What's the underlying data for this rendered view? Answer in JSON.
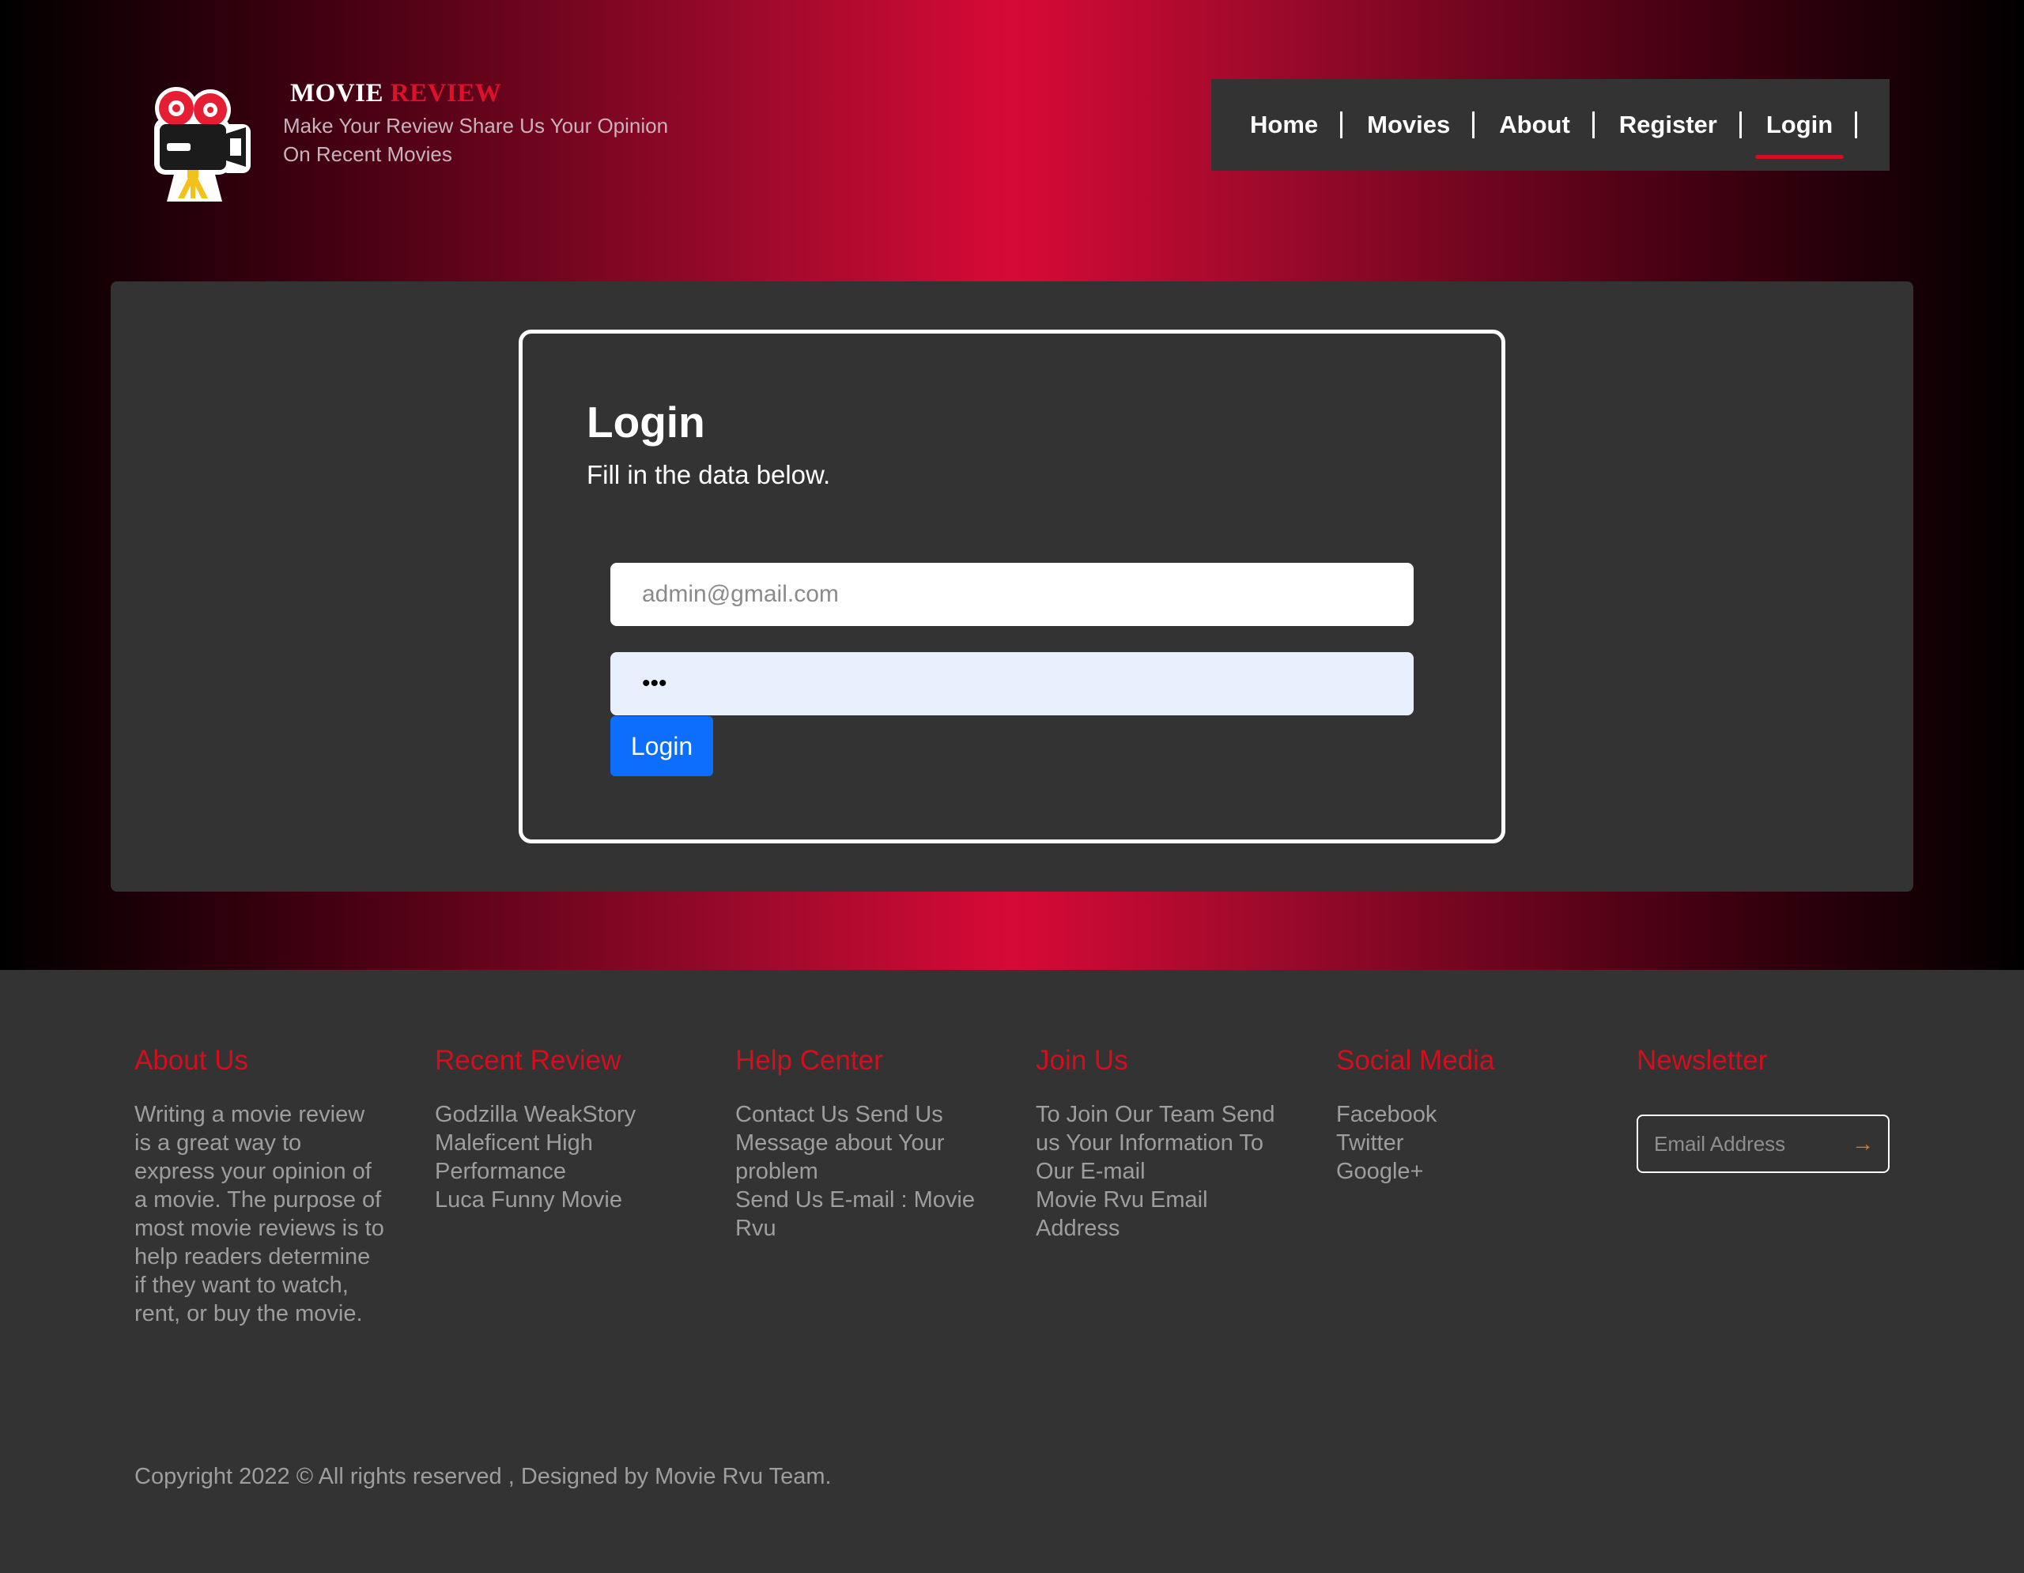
{
  "brand": {
    "title_part1": "MOVIE",
    "title_part2": "REVIEW",
    "tagline_line1": "Make Your Review Share Us Your Opinion",
    "tagline_line2": "On Recent Movies",
    "logo_icon": "movie-camera-icon"
  },
  "nav": {
    "items": [
      {
        "label": "Home"
      },
      {
        "label": "Movies"
      },
      {
        "label": "About"
      },
      {
        "label": "Register"
      },
      {
        "label": "Login",
        "active": true
      }
    ]
  },
  "login": {
    "title": "Login",
    "subtitle": "Fill in the data below.",
    "email_placeholder": "admin@gmail.com",
    "email_value": "",
    "password_value": "•••",
    "button_label": "Login"
  },
  "footer": {
    "about": {
      "heading": "About Us",
      "text": "Writing a movie review is a great way to express your opinion of a movie. The purpose of most movie reviews is to help readers determine if they want to watch, rent, or buy the movie."
    },
    "recent": {
      "heading": "Recent Review",
      "items": [
        "Godzilla WeakStory",
        "Maleficent High Performance",
        "Luca Funny Movie"
      ]
    },
    "help": {
      "heading": "Help Center",
      "items": [
        "Contact Us Send Us Message about Your problem",
        "Send Us E-mail : Movie Rvu"
      ]
    },
    "join": {
      "heading": "Join Us",
      "items": [
        "To Join Our Team Send us Your Information To Our E-mail",
        "Movie Rvu Email Address"
      ]
    },
    "social": {
      "heading": "Social Media",
      "items": [
        "Facebook",
        "Twitter",
        "Google+"
      ]
    },
    "newsletter": {
      "heading": "Newsletter",
      "placeholder": "Email Address",
      "arrow_icon": "arrow-right-icon"
    },
    "copyright": "Copyright 2022 © All rights reserved , Designed by Movie Rvu Team."
  },
  "colors": {
    "accent_red": "#d20f1c",
    "gradient_center": "#d70a36",
    "panel": "#333333",
    "button_blue": "#0d6efd"
  }
}
